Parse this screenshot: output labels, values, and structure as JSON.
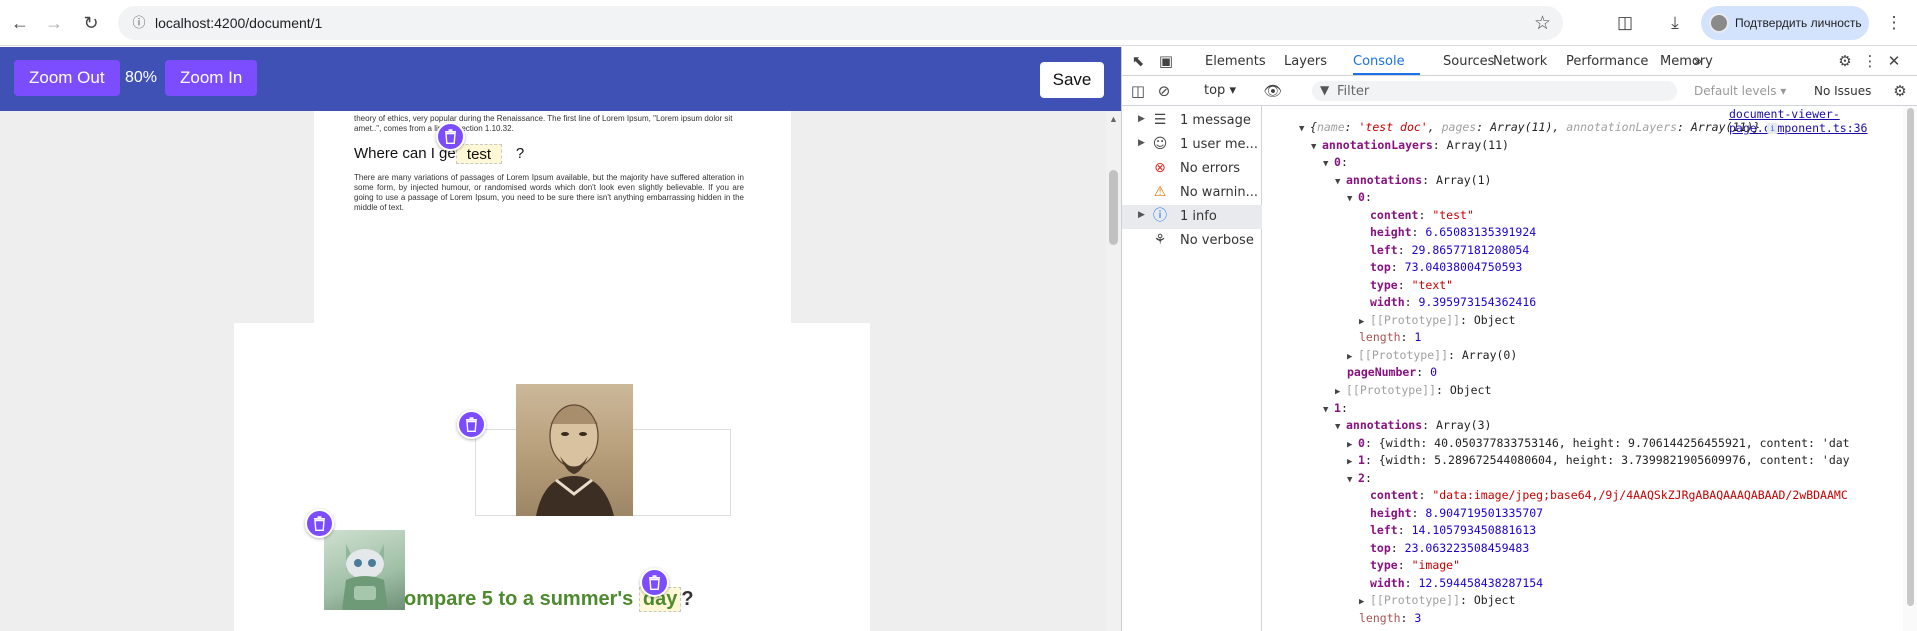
{
  "browser": {
    "url": "localhost:4200/document/1",
    "profile_label": "Подтвердить личность"
  },
  "toolbar": {
    "zoom_out_label": "Zoom Out",
    "zoom_level": "80%",
    "zoom_in_label": "Zoom In",
    "save_label": "Save"
  },
  "page1": {
    "intro_text": "theory of ethics, very popular during the Renaissance. The first line of Lorem Ipsum, \"Lorem ipsum dolor sit amet..\", comes from a line in section 1.10.32.",
    "heading": "Where can I get",
    "heading_tail": "?",
    "body_text": "There are many variations of passages of Lorem Ipsum available, but the majority have suffered alteration in some form, by injected humour, or randomised words which don't look even slightly believable. If you are going to use a passage of Lorem Ipsum, you need to be sure there isn't anything embarrassing hidden in the middle of text.",
    "annotation_text": "test"
  },
  "page2": {
    "title_prefix": "ompare 5 to a summer's",
    "title_annotation": "day",
    "title_suffix": "?"
  },
  "devtools": {
    "tabs": [
      "Elements",
      "Layers",
      "Console",
      "Sources",
      "Network",
      "Performance",
      "Memory"
    ],
    "active_tab": "Console",
    "context": "top",
    "filter_placeholder": "Filter",
    "levels": "Default levels",
    "issues": "No Issues",
    "sidebar": [
      {
        "label": "1 message",
        "icon": "list-icon",
        "expandable": true
      },
      {
        "label": "1 user me...",
        "icon": "user-icon",
        "expandable": true
      },
      {
        "label": "No errors",
        "icon": "error-icon",
        "expandable": false
      },
      {
        "label": "No warnin...",
        "icon": "warning-icon",
        "expandable": false
      },
      {
        "label": "1 info",
        "icon": "info-icon",
        "expandable": true
      },
      {
        "label": "No verbose",
        "icon": "bug-icon",
        "expandable": false
      }
    ],
    "source_link": "document-viewer-page.component.ts:36",
    "log": {
      "summary_name": "'test doc'",
      "summary_pages": "Array(11)",
      "summary_layers": "Array(11)",
      "annotationLayers": "Array(11)",
      "layer0_annotations": "Array(1)",
      "l0a0_content": "\"test\"",
      "l0a0_height": "6.65083135391924",
      "l0a0_left": "29.86577181208054",
      "l0a0_top": "73.04038004750593",
      "l0a0_type": "\"text\"",
      "l0a0_width": "9.395973154362416",
      "l0_length": "1",
      "l0_proto": "Array(0)",
      "l0_pageNumber": "0",
      "layer1_annotations": "Array(3)",
      "l1a0_summary": "{width: 40.050377833753146, height: 9.706144256455921, content: 'dat",
      "l1a1_summary": "{width: 5.289672544080604, height: 3.7399821905609976, content: 'day",
      "l1a2_content": "\"data:image/jpeg;base64,/9j/4AAQSkZJRgABAQAAAQABAAD/2wBDAAMC",
      "l1a2_height": "8.904719501335707",
      "l1a2_left": "14.105793450881613",
      "l1a2_top": "23.063223508459483",
      "l1a2_type": "\"image\"",
      "l1a2_width": "12.594458438287154",
      "l1_length": "3"
    }
  },
  "colors": {
    "app_toolbar": "#3f51b5",
    "accent_button": "#7c4dff",
    "title_green": "#4e8a2f",
    "devtools_active": "#1a73e8"
  }
}
